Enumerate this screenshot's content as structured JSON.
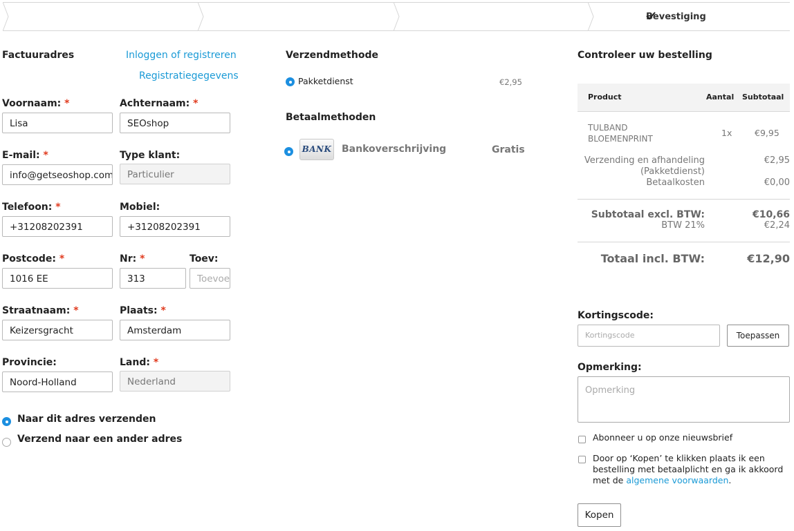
{
  "steps": {
    "final_label": "Bevestiging"
  },
  "billing": {
    "title": "Factuuradres",
    "login_link": "Inloggen of registreren",
    "reg_link": "Registratiegegevens",
    "fields": {
      "first_name": {
        "label": "Voornaam:",
        "value": "Lisa"
      },
      "last_name": {
        "label": "Achternaam:",
        "value": "SEOshop"
      },
      "email": {
        "label": "E-mail:",
        "value": "info@getseoshop.com"
      },
      "customer_type": {
        "label": "Type klant:",
        "value": "Particulier"
      },
      "phone": {
        "label": "Telefoon:",
        "value": "+31208202391"
      },
      "mobile": {
        "label": "Mobiel:",
        "value": "+31208202391"
      },
      "postcode": {
        "label": "Postcode:",
        "value": "1016 EE"
      },
      "number": {
        "label": "Nr:",
        "value": "313"
      },
      "addition": {
        "label": "Toev:",
        "placeholder": "Toevoeging"
      },
      "street": {
        "label": "Straatnaam:",
        "value": "Keizersgracht"
      },
      "city": {
        "label": "Plaats:",
        "value": "Amsterdam"
      },
      "province": {
        "label": "Provincie:",
        "value": "Noord-Holland"
      },
      "country": {
        "label": "Land:",
        "value": "Nederland"
      }
    },
    "required_mark": "*",
    "ship_same": "Naar dit adres verzenden",
    "ship_other": "Verzend naar een ander adres"
  },
  "shipping": {
    "title": "Verzendmethode",
    "option": "Pakketdienst",
    "price": "€2,95"
  },
  "payment": {
    "title": "Betaalmethoden",
    "icon_text": "BANK",
    "option": "Bankoverschrijving",
    "price": "Gratis"
  },
  "order": {
    "title": "Controleer uw bestelling",
    "headers": {
      "product": "Product",
      "qty": "Aantal",
      "subtotal": "Subtotaal"
    },
    "item": {
      "name_line1": "TULBAND",
      "name_line2": "BLOEMENPRINT",
      "qty": "1x",
      "price": "€9,95"
    },
    "shipping_label_1": "Verzending en afhandeling",
    "shipping_label_2": "(Pakketdienst)",
    "shipping_value": "€2,95",
    "payment_costs_label": "Betaalkosten",
    "payment_costs_value": "€0,00",
    "subtotal_label": "Subtotaal excl. BTW:",
    "subtotal_value": "€10,66",
    "vat_label": "BTW 21%",
    "vat_value": "€2,24",
    "total_label": "Totaal incl. BTW:",
    "total_value": "€12,90"
  },
  "discount": {
    "title": "Kortingscode:",
    "placeholder": "Kortingscode",
    "apply": "Toepassen"
  },
  "remark": {
    "title": "Opmerking:",
    "placeholder": "Opmerking"
  },
  "newsletter": "Abonneer u op onze nieuwsbrief",
  "terms": {
    "line1": "Door op ‘Kopen’ te klikken plaats ik een",
    "line2": "bestelling met betaalplicht en ga ik akkoord",
    "line3_prefix": "met de ",
    "link": "algemene voorwaarden",
    "line3_suffix": "."
  },
  "buy_button": "Kopen"
}
